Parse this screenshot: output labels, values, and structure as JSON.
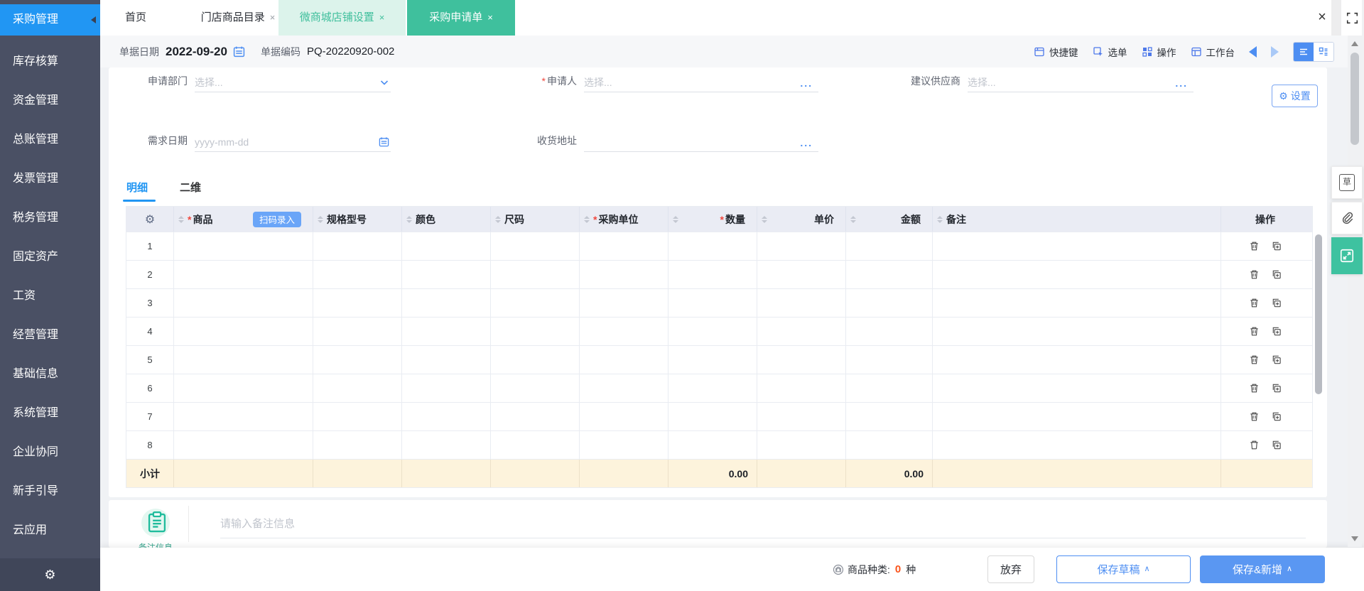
{
  "icons": {
    "gear": "⚙",
    "close": "×",
    "caret_up": "∧"
  },
  "sidebar": {
    "active": "采购管理",
    "items": [
      "库存核算",
      "资金管理",
      "总账管理",
      "发票管理",
      "税务管理",
      "固定资产",
      "工资",
      "经营管理",
      "基础信息",
      "系统管理",
      "企业协同",
      "新手引导",
      "云应用"
    ]
  },
  "tabbar": {
    "home": "首页",
    "catalog": "门店商品目录",
    "shop_settings": "微商城店铺设置",
    "purchase_request": "采购申请单"
  },
  "header": {
    "date_label": "单据日期",
    "date_value": "2022-09-20",
    "code_label": "单据编码",
    "code_value": "PQ-20220920-002",
    "actions": [
      "快捷键",
      "选单",
      "操作",
      "工作台"
    ]
  },
  "form": {
    "dept_label": "申请部门",
    "dept_placeholder": "选择...",
    "applicant_label": "申请人",
    "applicant_placeholder": "选择...",
    "supplier_label": "建议供应商",
    "supplier_placeholder": "选择...",
    "need_date_label": "需求日期",
    "need_date_placeholder": "yyyy-mm-dd",
    "address_label": "收货地址",
    "required_mark": "*",
    "ellipsis": "...",
    "settings_label": "设置"
  },
  "detail_tabs": {
    "detail": "明细",
    "dimension": "二维"
  },
  "table": {
    "columns": [
      {
        "label": "商品",
        "required": true,
        "button": "扫码录入"
      },
      {
        "label": "规格型号"
      },
      {
        "label": "颜色"
      },
      {
        "label": "尺码"
      },
      {
        "label": "采购单位",
        "required": true
      },
      {
        "label": "数量",
        "required": true,
        "align": "right"
      },
      {
        "label": "单价",
        "align": "right"
      },
      {
        "label": "金额",
        "align": "right"
      },
      {
        "label": "备注"
      },
      {
        "label": "操作"
      }
    ],
    "row_numbers": [
      "1",
      "2",
      "3",
      "4",
      "5",
      "6",
      "7",
      "8"
    ],
    "subtotal": {
      "label": "小计",
      "qty": "0.00",
      "amount": "0.00"
    }
  },
  "remark": {
    "label": "备注信息",
    "placeholder": "请输入备注信息"
  },
  "footer": {
    "type_label": "商品种类:",
    "type_count": "0",
    "type_unit": "种",
    "cancel": "放弃",
    "save_draft": "保存草稿",
    "save_new": "保存&新增"
  },
  "colors": {
    "accent_blue": "#2196f3",
    "accent_green": "#3fc09d",
    "link_blue": "#4d8ef2",
    "count_orange": "#fa541c"
  }
}
